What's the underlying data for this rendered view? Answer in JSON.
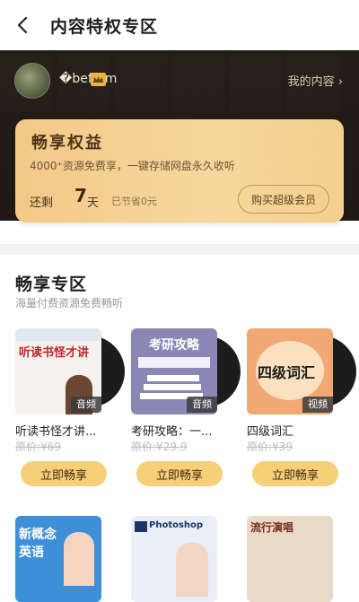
{
  "header": {
    "title": "内容特权专区"
  },
  "user": {
    "name": "�befrom",
    "my_content_label": "我的内容"
  },
  "card": {
    "title": "畅享权益",
    "desc": "4000⁺资源免费享，一键存储网盘永久收听",
    "remain_label": "还剩",
    "remain_days": "7",
    "remain_unit": "天",
    "saved": "已节省0元",
    "buy_label": "购买超级会员"
  },
  "section": {
    "title": "畅享专区",
    "subtitle": "海量付费资源免费畅听"
  },
  "items": [
    {
      "title": "听读书怪才讲...",
      "price": "原价:¥69",
      "tag": "音频",
      "button": "立即畅享",
      "cover_text": "听读书怪才讲",
      "cover_color": "#f4f1ee"
    },
    {
      "title": "考研攻略：一...",
      "price": "原价:¥29.9",
      "tag": "音频",
      "button": "立即畅享",
      "cover_text": "考研攻略",
      "cover_color": "#8a87b4"
    },
    {
      "title": "四级词汇",
      "price": "原价:¥39",
      "tag": "视频",
      "button": "立即畅享",
      "cover_text": "四级词汇",
      "cover_color": "#f2a875"
    }
  ],
  "row2": [
    {
      "cover_text": "新概念英语",
      "cover_color": "#3d8fd8"
    },
    {
      "cover_text": "Photoshop",
      "cover_color": "#e9eef8"
    },
    {
      "cover_text": "流行演唱",
      "cover_color": "#e9d9c7"
    }
  ]
}
